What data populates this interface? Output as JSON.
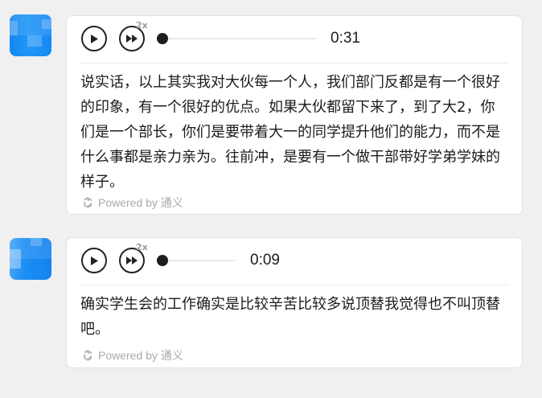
{
  "messages": [
    {
      "speed_label": "2x",
      "time": "0:31",
      "progress": 0,
      "transcript": "说实话，以上其实我对大伙每一个人，我们部门反都是有一个很好的印象，有一个很好的优点。如果大伙都留下来了，到了大2，你们是一个部长，你们是要带着大一的同学提升他们的能力，而不是什么事都是亲力亲为。往前冲，是要有一个做干部带好学弟学妹的样子。",
      "powered_by": "Powered by 通义"
    },
    {
      "speed_label": "2x",
      "time": "0:09",
      "progress": 0,
      "transcript": "确实学生会的工作确实是比较辛苦比较多说顶替我觉得也不叫顶替吧。",
      "powered_by": "Powered by 通义"
    }
  ],
  "colors": {
    "avatar": "#1689f2",
    "text": "#1c1c1c",
    "muted": "#a9a9a9",
    "background": "#f0f0f1"
  }
}
